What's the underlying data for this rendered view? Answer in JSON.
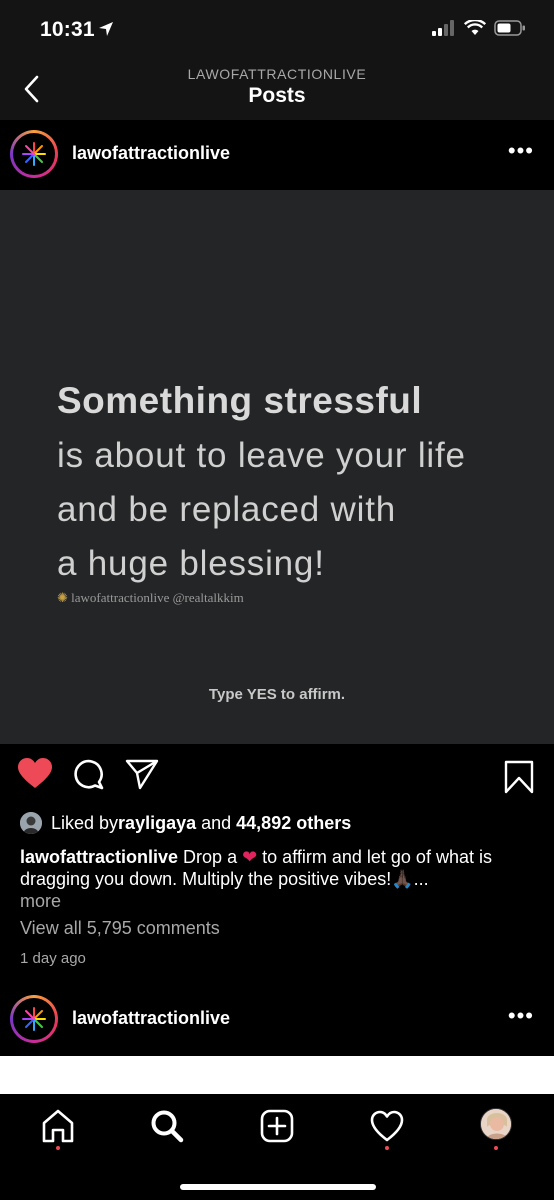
{
  "status_bar": {
    "time": "10:31"
  },
  "nav": {
    "subtitle": "LAWOFATTRACTIONLIVE",
    "title": "Posts"
  },
  "post": {
    "username": "lawofattractionlive",
    "image": {
      "headline": "Something stressful",
      "lines": [
        "is about to leave your life",
        "and be replaced with",
        "a huge blessing!"
      ],
      "credit": "lawofattractionlive @realtalkkim",
      "cta": "Type YES to affirm."
    },
    "likes": {
      "prefix": "Liked by ",
      "user": "rayligaya",
      "middle": " and ",
      "count": "44,892 others"
    },
    "caption": {
      "username": "lawofattractionlive",
      "text_before_emoji": " Drop a ",
      "text_after_emoji": " to affirm and let go of what is dragging you down. Multiply the positive vibes!",
      "ellipsis": "🙏🏿...",
      "more": "more"
    },
    "comments_link": "View all 5,795 comments",
    "time_ago": "1 day ago"
  },
  "next_post": {
    "username": "lawofattractionlive"
  },
  "colors": {
    "like_red": "#ed4956",
    "image_bg": "#242526"
  },
  "icons": [
    "back-arrow-icon",
    "location-arrow-icon",
    "signal-icon",
    "wifi-icon",
    "battery-icon",
    "more-options-icon",
    "heart-icon",
    "comment-icon",
    "share-icon",
    "bookmark-icon",
    "home-icon",
    "search-icon",
    "add-post-icon",
    "activity-heart-icon",
    "profile-avatar"
  ]
}
